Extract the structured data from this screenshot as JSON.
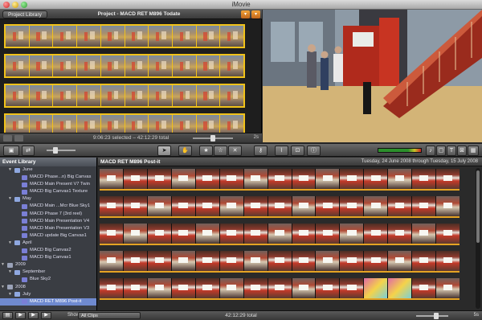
{
  "window": {
    "title": "iMovie"
  },
  "project": {
    "library_button": "Project Library",
    "title": "Project - MACD RET M896 Todate",
    "time_text": "9:06:23 selected – 42:12:29 total",
    "zoom_value": "2s"
  },
  "event_library": {
    "header": "Event Library",
    "rows": [
      {
        "type": "group",
        "label": "June",
        "indent": 2
      },
      {
        "type": "event",
        "label": "MACD Phase...n) Big Canvas",
        "indent": 3
      },
      {
        "type": "event",
        "label": "MACD Main Present V7 Twin",
        "indent": 3
      },
      {
        "type": "event",
        "label": "MACD Big Canvas1 Texture",
        "indent": 3
      },
      {
        "type": "group",
        "label": "May",
        "indent": 2
      },
      {
        "type": "event",
        "label": "MACD Main ...Mcr Blue Sky1",
        "indent": 3
      },
      {
        "type": "event",
        "label": "MACD Phase 7 (3rd reel)",
        "indent": 3
      },
      {
        "type": "event",
        "label": "MACD Main Presentation V4",
        "indent": 3
      },
      {
        "type": "event",
        "label": "MACD Main Presentation V3",
        "indent": 3
      },
      {
        "type": "event",
        "label": "MACD update Big Canvas1",
        "indent": 3
      },
      {
        "type": "group",
        "label": "April",
        "indent": 2
      },
      {
        "type": "event",
        "label": "MACD Big Canvas2",
        "indent": 3
      },
      {
        "type": "event",
        "label": "MACD Big Canvas1",
        "indent": 3
      },
      {
        "type": "year",
        "label": "2009",
        "indent": 1
      },
      {
        "type": "group",
        "label": "September",
        "indent": 2
      },
      {
        "type": "event",
        "label": "Blue Sky2",
        "indent": 3
      },
      {
        "type": "year",
        "label": "2008",
        "indent": 1
      },
      {
        "type": "group",
        "label": "July",
        "indent": 2
      },
      {
        "type": "event",
        "label": "MACD RET M896 Post-it",
        "indent": 3,
        "selected": true
      }
    ]
  },
  "event_browser": {
    "title": "MACD RET M896 Post-it",
    "date_range": "Tuesday, 24 June 2008 through Tuesday, 15 July 2008"
  },
  "bottom": {
    "show_label": "Show:",
    "show_value": "All Clips",
    "total": "42:12:29 total",
    "zoom_value": "5s"
  }
}
